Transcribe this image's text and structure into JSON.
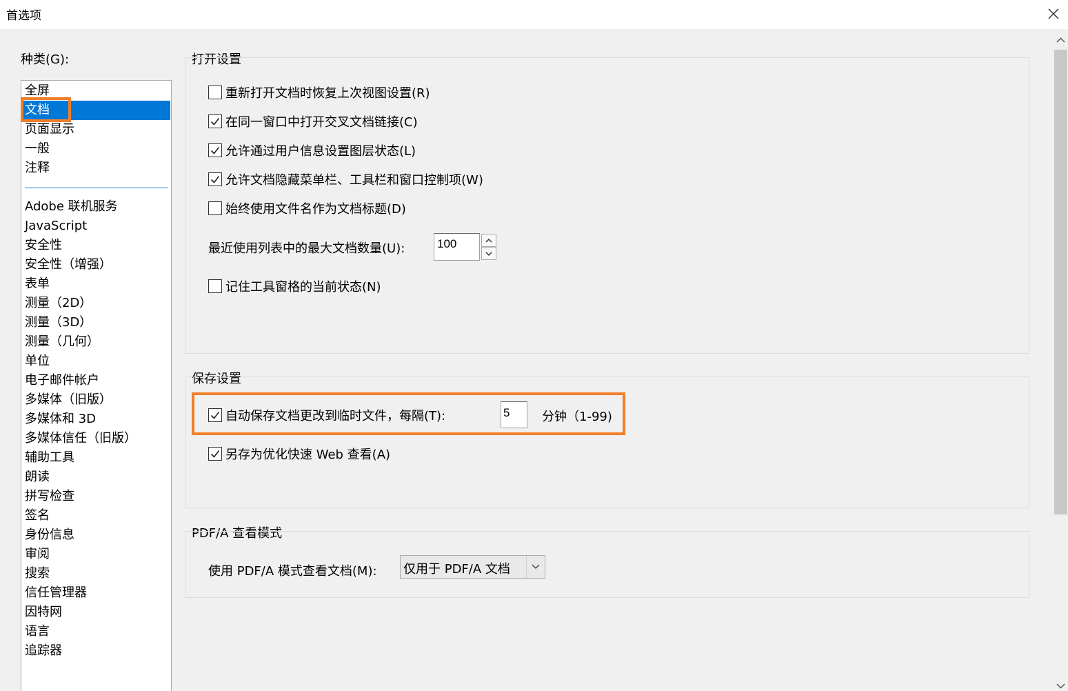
{
  "window": {
    "title": "首选项"
  },
  "sidebar": {
    "label": "种类(G):",
    "top_items": [
      {
        "label": "全屏",
        "selected": false
      },
      {
        "label": "文档",
        "selected": true
      },
      {
        "label": "页面显示",
        "selected": false
      },
      {
        "label": "一般",
        "selected": false
      },
      {
        "label": "注释",
        "selected": false
      }
    ],
    "items": [
      "Adobe 联机服务",
      "JavaScript",
      "安全性",
      "安全性（增强）",
      "表单",
      "测量（2D）",
      "测量（3D）",
      "测量（几何）",
      "单位",
      "电子邮件帐户",
      "多媒体（旧版）",
      "多媒体和 3D",
      "多媒体信任（旧版）",
      "辅助工具",
      "朗读",
      "拼写检查",
      "签名",
      "身份信息",
      "审阅",
      "搜索",
      "信任管理器",
      "因特网",
      "语言",
      "追踪器"
    ]
  },
  "open_settings": {
    "title": "打开设置",
    "options": [
      {
        "label": "重新打开文档时恢复上次视图设置(R)",
        "checked": false
      },
      {
        "label": "在同一窗口中打开交叉文档链接(C)",
        "checked": true
      },
      {
        "label": "允许通过用户信息设置图层状态(L)",
        "checked": true
      },
      {
        "label": "允许文档隐藏菜单栏、工具栏和窗口控制项(W)",
        "checked": true
      },
      {
        "label": "始终使用文件名作为文档标题(D)",
        "checked": false
      }
    ],
    "max_docs_label": "最近使用列表中的最大文档数量(U):",
    "max_docs_value": "100",
    "remember_tools": {
      "label": "记住工具窗格的当前状态(N)",
      "checked": false
    }
  },
  "save_settings": {
    "title": "保存设置",
    "autosave": {
      "label": "自动保存文档更改到临时文件，每隔(T):",
      "checked": true,
      "interval": "5",
      "unit": "分钟（1-99)"
    },
    "fast_web": {
      "label": "另存为优化快速 Web 查看(A)",
      "checked": true
    }
  },
  "pdfa": {
    "title": "PDF/A 查看模式",
    "label": "使用 PDF/A 模式查看文档(M):",
    "selected": "仅用于 PDF/A 文档"
  },
  "colors": {
    "selection": "#0078d7",
    "highlight": "#f07f2a"
  }
}
